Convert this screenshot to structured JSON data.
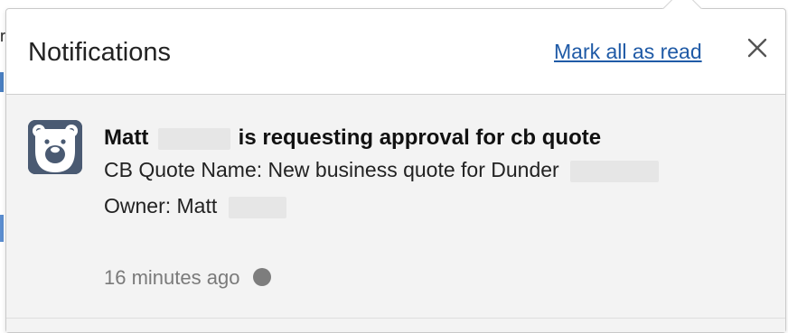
{
  "background": {
    "edge_char": "r"
  },
  "notifications": {
    "title": "Notifications",
    "mark_all_label": "Mark all as read",
    "close_icon": "close-icon",
    "accent_color": "#1f5aa6",
    "items": [
      {
        "avatar_icon": "bear-avatar-icon",
        "title_first_name": "Matt",
        "title_rest": "is requesting approval for cb quote",
        "quote_name_line": "CB Quote Name: New business quote for Dunder",
        "owner_line": "Owner: Matt",
        "time": "16 minutes ago",
        "unread": true
      }
    ]
  }
}
